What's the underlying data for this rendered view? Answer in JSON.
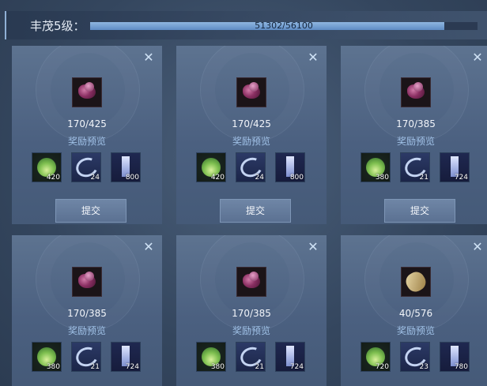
{
  "header": {
    "level_label": "丰茂5级：",
    "progress_text": "51302/56100",
    "progress_current": 51302,
    "progress_max": 56100
  },
  "labels": {
    "reward_preview": "奖励预览",
    "submit": "提交"
  },
  "cards": [
    {
      "item_icon": "purple-gem-icon",
      "count": "170/425",
      "rewards": [
        "420",
        "24",
        "800"
      ]
    },
    {
      "item_icon": "purple-gem-icon",
      "count": "170/425",
      "rewards": [
        "420",
        "24",
        "800"
      ]
    },
    {
      "item_icon": "purple-gem-icon",
      "count": "170/385",
      "rewards": [
        "380",
        "21",
        "724"
      ]
    },
    {
      "item_icon": "purple-gem-icon",
      "count": "170/385",
      "rewards": [
        "380",
        "21",
        "724"
      ]
    },
    {
      "item_icon": "purple-gem-icon",
      "count": "170/385",
      "rewards": [
        "380",
        "21",
        "724"
      ]
    },
    {
      "item_icon": "wood-scroll-icon",
      "count": "40/576",
      "rewards": [
        "720",
        "23",
        "780"
      ]
    }
  ],
  "reward_icons": [
    "green-leaf-icon",
    "blue-swirl-icon",
    "crystal-pillar-icon"
  ],
  "colors": {
    "progress_fill": "#8fb6e0",
    "preview_text": "#9fc0e6",
    "card_bg": "#5d7390"
  }
}
